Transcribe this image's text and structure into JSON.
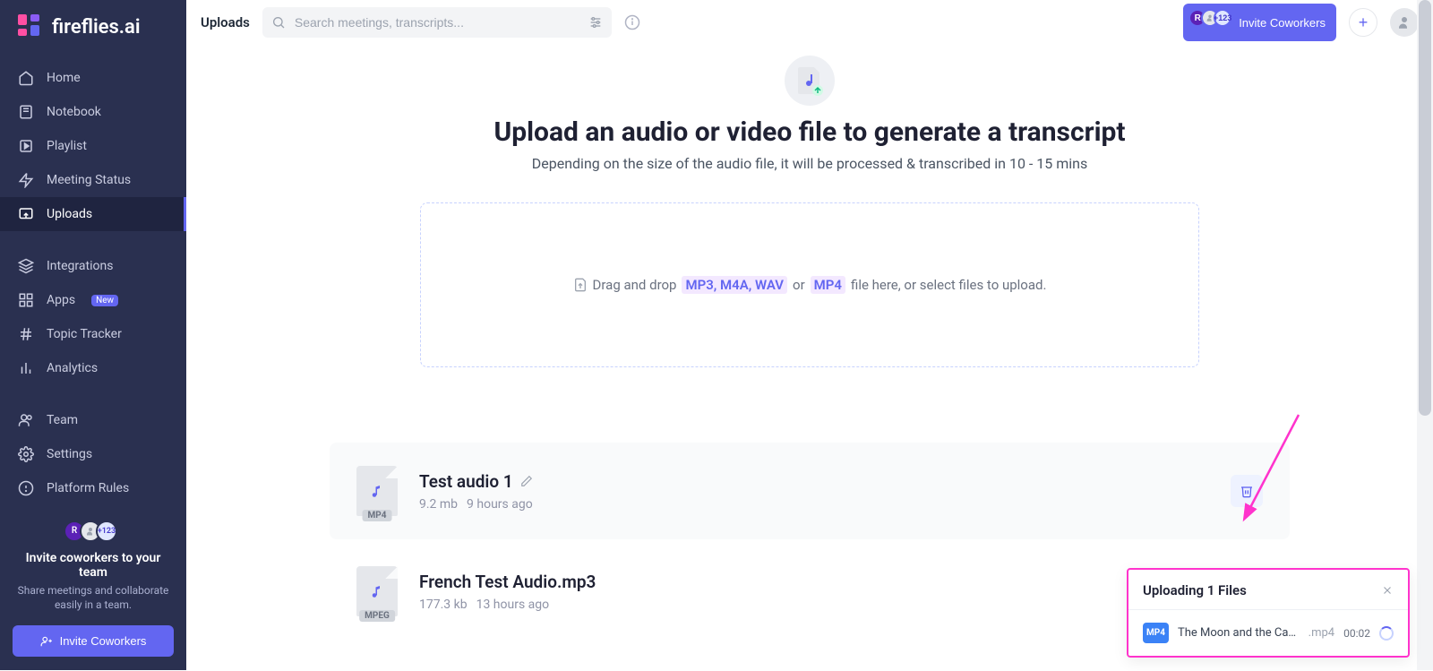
{
  "brand": {
    "name": "fireflies.ai"
  },
  "sidebar": {
    "items": [
      {
        "label": "Home",
        "icon": "home-icon"
      },
      {
        "label": "Notebook",
        "icon": "notebook-icon"
      },
      {
        "label": "Playlist",
        "icon": "playlist-icon"
      },
      {
        "label": "Meeting Status",
        "icon": "status-icon"
      },
      {
        "label": "Uploads",
        "icon": "uploads-icon",
        "active": true
      },
      {
        "label": "Integrations",
        "icon": "integrations-icon"
      },
      {
        "label": "Apps",
        "icon": "apps-icon",
        "badge": "New"
      },
      {
        "label": "Topic Tracker",
        "icon": "topic-icon"
      },
      {
        "label": "Analytics",
        "icon": "analytics-icon"
      },
      {
        "label": "Team",
        "icon": "team-icon"
      },
      {
        "label": "Settings",
        "icon": "settings-icon"
      },
      {
        "label": "Platform Rules",
        "icon": "rules-icon"
      }
    ],
    "invite": {
      "title": "Invite coworkers to your team",
      "subtitle": "Share meetings and collaborate easily in a team.",
      "button": "Invite Coworkers",
      "avatar_letter": "R",
      "avatar_count": "+123"
    }
  },
  "topbar": {
    "title": "Uploads",
    "search_placeholder": "Search meetings, transcripts...",
    "invite_button": "Invite Coworkers",
    "avatar_letter": "R",
    "avatar_count": "+123"
  },
  "hero": {
    "title": "Upload an audio or video file to generate a transcript",
    "subtitle": "Depending on the size of the audio file, it will be processed & transcribed in 10 - 15 mins"
  },
  "dropzone": {
    "pre": "Drag and drop",
    "formats_audio": "MP3, M4A, WAV",
    "or": "or",
    "formats_video": "MP4",
    "post": "file here, or select files to upload."
  },
  "files": [
    {
      "name": "Test audio 1",
      "format": "MP4",
      "size": "9.2 mb",
      "age": "9 hours ago"
    },
    {
      "name": "French Test Audio.mp3",
      "format": "MPEG",
      "size": "177.3 kb",
      "age": "13 hours ago"
    }
  ],
  "upload_popup": {
    "title": "Uploading 1 Files",
    "badge": "MP4",
    "filename": "The Moon and the Ca…",
    "ext": ".mp4",
    "time": "00:02"
  }
}
